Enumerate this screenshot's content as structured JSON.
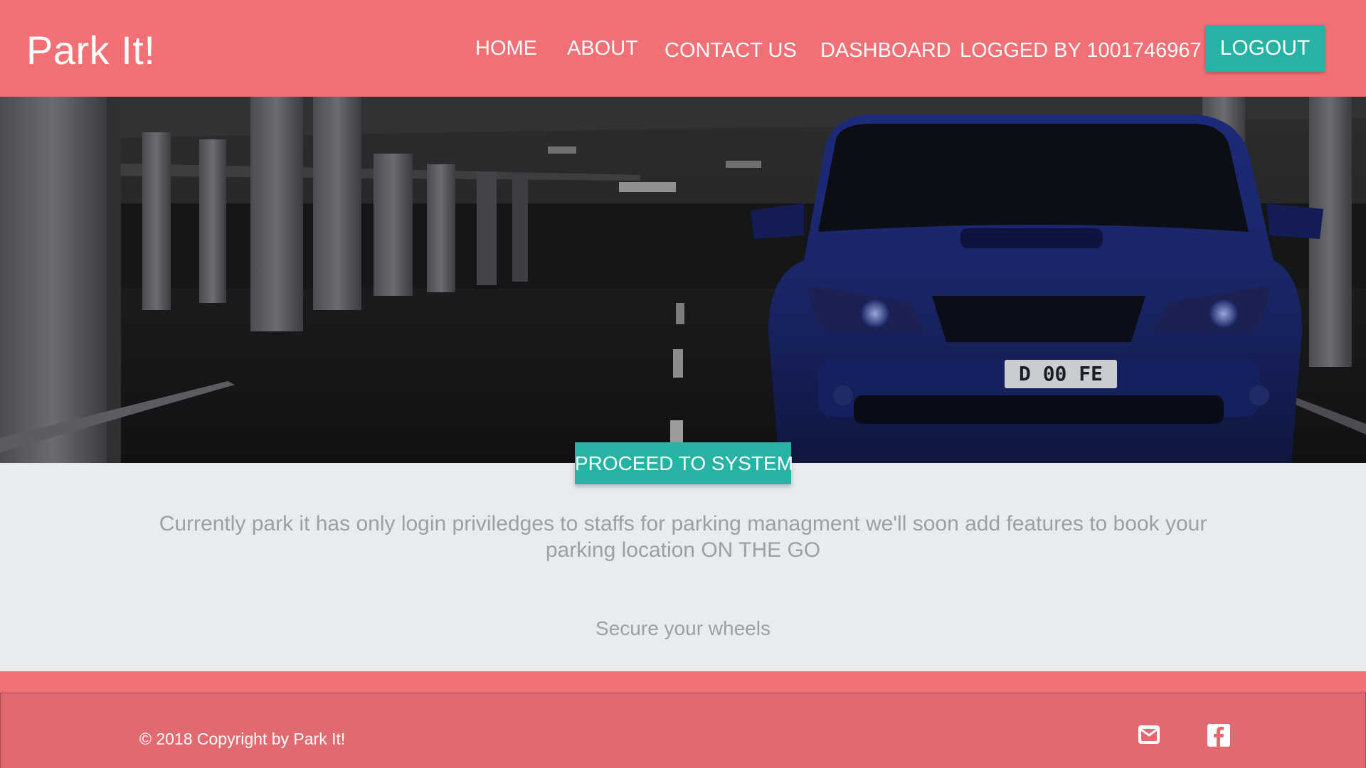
{
  "header": {
    "brand": "Park It!",
    "nav": {
      "home": "HOME",
      "about": "ABOUT",
      "contact": "CONTACT US",
      "dashboard": "DASHBOARD",
      "logged_by": "LOGGED BY 1001746967"
    },
    "logout_label": "LOGOUT"
  },
  "hero": {
    "plate_text": "D  00 FE",
    "proceed_label": "PROCEED TO SYSTEM"
  },
  "content": {
    "description": "Currently park it has only login priviledges to staffs for parking managment we'll soon add features to book your parking location ON THE GO",
    "tagline": "Secure your wheels"
  },
  "footer": {
    "copyright": "© 2018 Copyright by Park It!",
    "icons": [
      "envelope-icon",
      "facebook-icon"
    ]
  },
  "colors": {
    "header_bg": "#f07075",
    "accent": "#26b3a4",
    "content_bg": "#e9ecef",
    "footer_bg": "#e06a70",
    "muted_text": "#9aa0a6"
  }
}
